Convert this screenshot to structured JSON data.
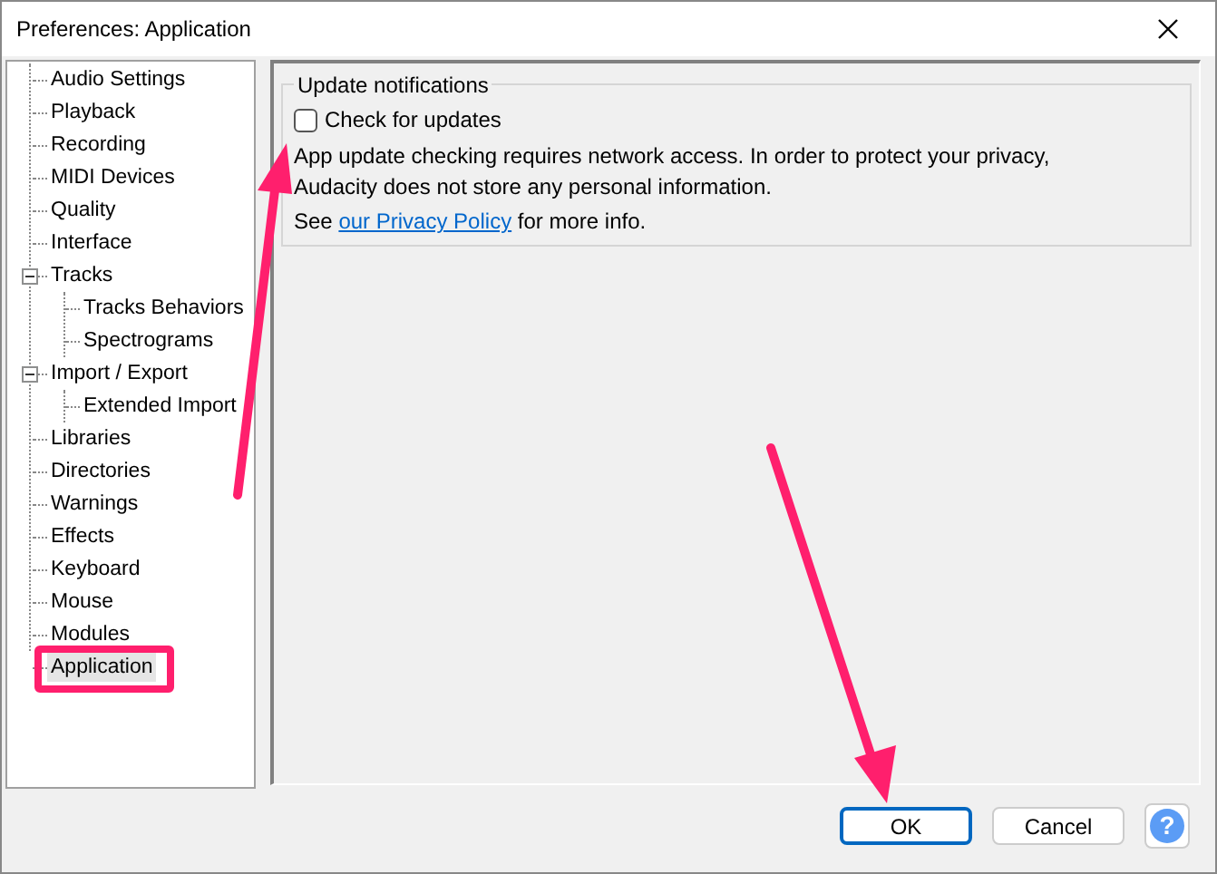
{
  "window": {
    "title": "Preferences: Application"
  },
  "tree": [
    {
      "label": "Audio Settings",
      "selected": false
    },
    {
      "label": "Playback",
      "selected": false
    },
    {
      "label": "Recording",
      "selected": false
    },
    {
      "label": "MIDI Devices",
      "selected": false
    },
    {
      "label": "Quality",
      "selected": false
    },
    {
      "label": "Interface",
      "selected": false
    },
    {
      "label": "Tracks",
      "selected": false,
      "expanded": true,
      "children": [
        {
          "label": "Tracks Behaviors",
          "selected": false
        },
        {
          "label": "Spectrograms",
          "selected": false
        }
      ]
    },
    {
      "label": "Import / Export",
      "selected": false,
      "expanded": true,
      "children": [
        {
          "label": "Extended Import",
          "selected": false
        }
      ]
    },
    {
      "label": "Libraries",
      "selected": false
    },
    {
      "label": "Directories",
      "selected": false
    },
    {
      "label": "Warnings",
      "selected": false
    },
    {
      "label": "Effects",
      "selected": false
    },
    {
      "label": "Keyboard",
      "selected": false
    },
    {
      "label": "Mouse",
      "selected": false
    },
    {
      "label": "Modules",
      "selected": false
    },
    {
      "label": "Application",
      "selected": true
    }
  ],
  "group": {
    "title": "Update notifications",
    "checkbox": {
      "label": "Check for updates",
      "checked": false
    },
    "description": "App update checking requires network access. In order to protect your privacy, Audacity does not store any personal information.",
    "note_before": "See",
    "link": "our Privacy Policy",
    "note_after": "for more info."
  },
  "buttons": [
    {
      "label": "OK",
      "selected": true
    },
    {
      "label": "Cancel",
      "selected": false
    }
  ],
  "help_button": {
    "label": "?"
  }
}
